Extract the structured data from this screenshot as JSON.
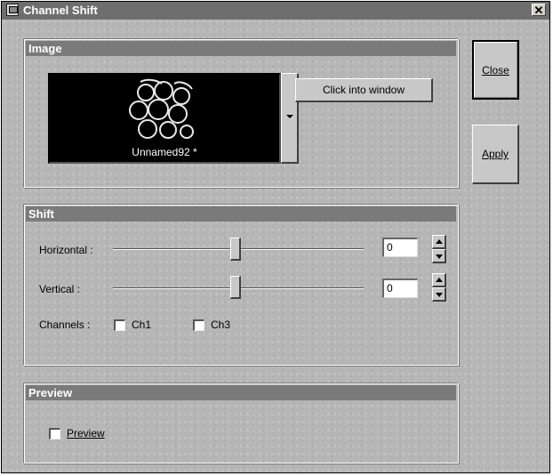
{
  "window": {
    "title": "Channel Shift",
    "close_glyph": "✕"
  },
  "side_buttons": {
    "close_label": "Close",
    "apply_label": "Apply"
  },
  "image_group": {
    "heading": "Image",
    "thumbnail_caption": "Unnamed92 *",
    "click_button_label": "Click into window"
  },
  "shift_group": {
    "heading": "Shift",
    "horizontal_label": "Horizontal :",
    "horizontal_value": "0",
    "vertical_label": "Vertical :",
    "vertical_value": "0",
    "channels_label": "Channels :",
    "channels": [
      {
        "label": "Ch1",
        "checked": false
      },
      {
        "label": "Ch3",
        "checked": false
      }
    ]
  },
  "preview_group": {
    "heading": "Preview",
    "preview_label": "Preview",
    "preview_checked": false
  }
}
